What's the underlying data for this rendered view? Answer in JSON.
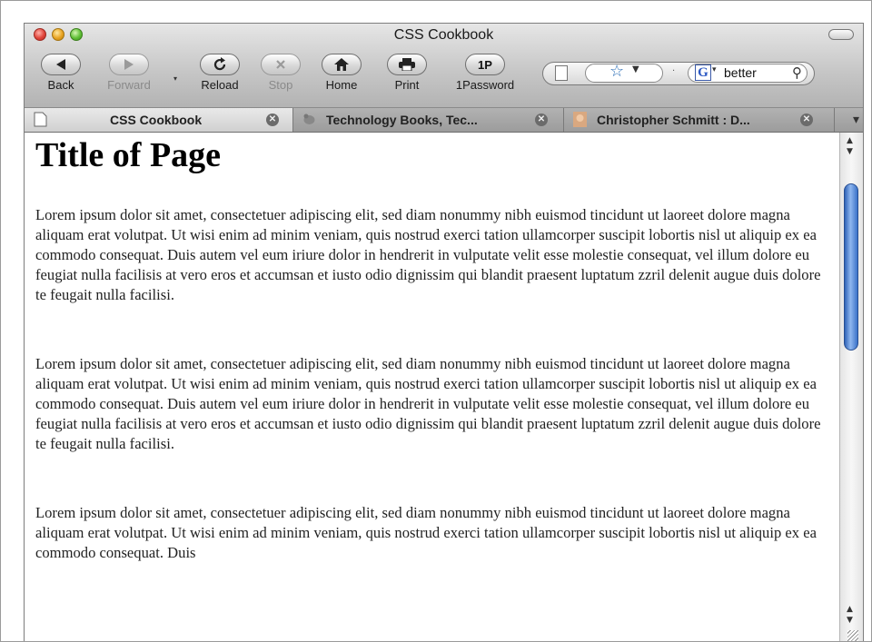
{
  "window": {
    "title": "CSS Cookbook"
  },
  "toolbar": {
    "back_label": "Back",
    "forward_label": "Forward",
    "reload_label": "Reload",
    "stop_label": "Stop",
    "home_label": "Home",
    "print_label": "Print",
    "onepassword_label": "1Password",
    "onepassword_button_text": "1P"
  },
  "search": {
    "value": "better"
  },
  "tabs": [
    {
      "label": "CSS Cookbook",
      "active": true
    },
    {
      "label": "Technology Books, Tec...",
      "active": false
    },
    {
      "label": "Christopher Schmitt : D...",
      "active": false
    }
  ],
  "page": {
    "heading": "Title of Page",
    "paragraphs": [
      "Lorem ipsum dolor sit amet, consectetuer adipiscing elit, sed diam nonummy nibh euismod tincidunt ut laoreet dolore magna aliquam erat volutpat. Ut wisi enim ad minim veniam, quis nostrud exerci tation ullamcorper suscipit lobortis nisl ut aliquip ex ea commodo consequat. Duis autem vel eum iriure dolor in hendrerit in vulputate velit esse molestie consequat, vel illum dolore eu feugiat nulla facilisis at vero eros et accumsan et iusto odio dignissim qui blandit praesent luptatum zzril delenit augue duis dolore te feugait nulla facilisi.",
      "Lorem ipsum dolor sit amet, consectetuer adipiscing elit, sed diam nonummy nibh euismod tincidunt ut laoreet dolore magna aliquam erat volutpat. Ut wisi enim ad minim veniam, quis nostrud exerci tation ullamcorper suscipit lobortis nisl ut aliquip ex ea commodo consequat. Duis autem vel eum iriure dolor in hendrerit in vulputate velit esse molestie consequat, vel illum dolore eu feugiat nulla facilisis at vero eros et accumsan et iusto odio dignissim qui blandit praesent luptatum zzril delenit augue duis dolore te feugait nulla facilisi.",
      "Lorem ipsum dolor sit amet, consectetuer adipiscing elit, sed diam nonummy nibh euismod tincidunt ut laoreet dolore magna aliquam erat volutpat. Ut wisi enim ad minim veniam, quis nostrud exerci tation ullamcorper suscipit lobortis nisl ut aliquip ex ea commodo consequat. Duis"
    ]
  },
  "icons": {
    "back": "left-arrow-icon",
    "forward": "right-arrow-icon",
    "reload": "reload-icon",
    "stop": "stop-x-icon",
    "home": "home-icon",
    "print": "printer-icon",
    "bookmark": "star-icon",
    "search_engine": "google-icon",
    "search": "magnifier-icon"
  },
  "colors": {
    "scroll_thumb": "#3a72c9",
    "star": "#2c6fb7"
  }
}
